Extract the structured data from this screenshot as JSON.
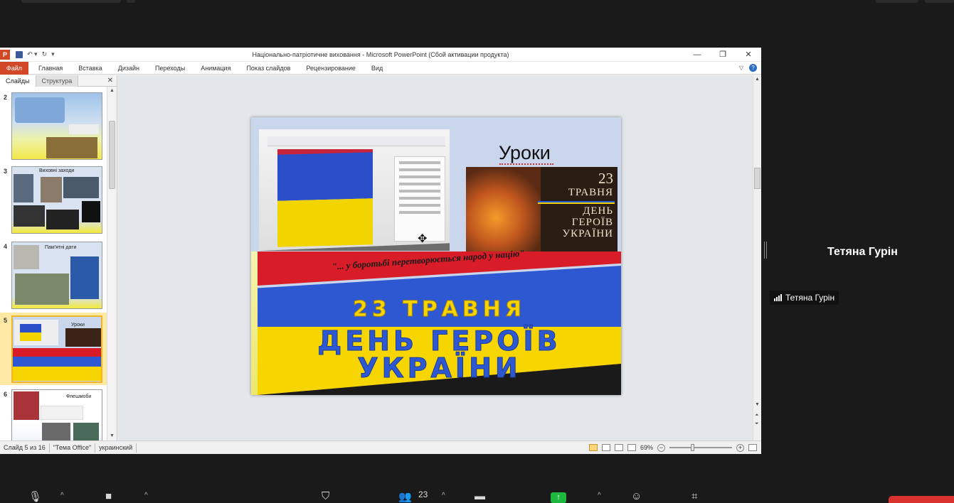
{
  "powerpoint": {
    "logo": "P",
    "window_title": "Національно-патріотичне виховання  -  Microsoft PowerPoint (Сбой активации продукта)",
    "window_controls": [
      "—",
      "❐",
      "✕"
    ],
    "file_tab": "Файл",
    "ribbon_tabs": [
      "Главная",
      "Вставка",
      "Дизайн",
      "Переходы",
      "Анимация",
      "Показ слайдов",
      "Рецензирование",
      "Вид"
    ],
    "panel_tabs": [
      "Слайды",
      "Структура"
    ],
    "thumbnails": [
      {
        "num": "2",
        "title": ""
      },
      {
        "num": "3",
        "title": "Виховні заходи"
      },
      {
        "num": "4",
        "title": "Пам'ятні дати"
      },
      {
        "num": "5",
        "title": "Уроки"
      },
      {
        "num": "6",
        "title": "Флешмоби"
      }
    ],
    "selected_slide": "5",
    "slide": {
      "heading": "Уроки",
      "card_number": "23",
      "card_month": "ТРАВНЯ",
      "card_line1": "ДЕНЬ",
      "card_line2": "ГЕРОЇВ",
      "card_line3": "УКРАЇНИ",
      "quote": "\"... у боротьбі перетворюється народ у націю\"",
      "banner_line1": "23 ТРАВНЯ",
      "banner_line2": "ДЕНЬ ГЕРОЇВ",
      "banner_line3": "УКРАЇНИ"
    },
    "status": {
      "slide_counter": "Слайд 5 из 16",
      "theme": "\"Тема Office\"",
      "language": "украинский",
      "zoom": "69%"
    }
  },
  "zoom_meeting": {
    "participant_name": "Тетяна Гурін",
    "participant_label": "Тетяна Гурін",
    "participants_count": "23"
  },
  "colors": {
    "ppt_accent": "#d24726",
    "flag_blue": "#2e58d1",
    "flag_yellow": "#f7d500",
    "share_green": "#1fb83f",
    "end_red": "#d8312e"
  }
}
